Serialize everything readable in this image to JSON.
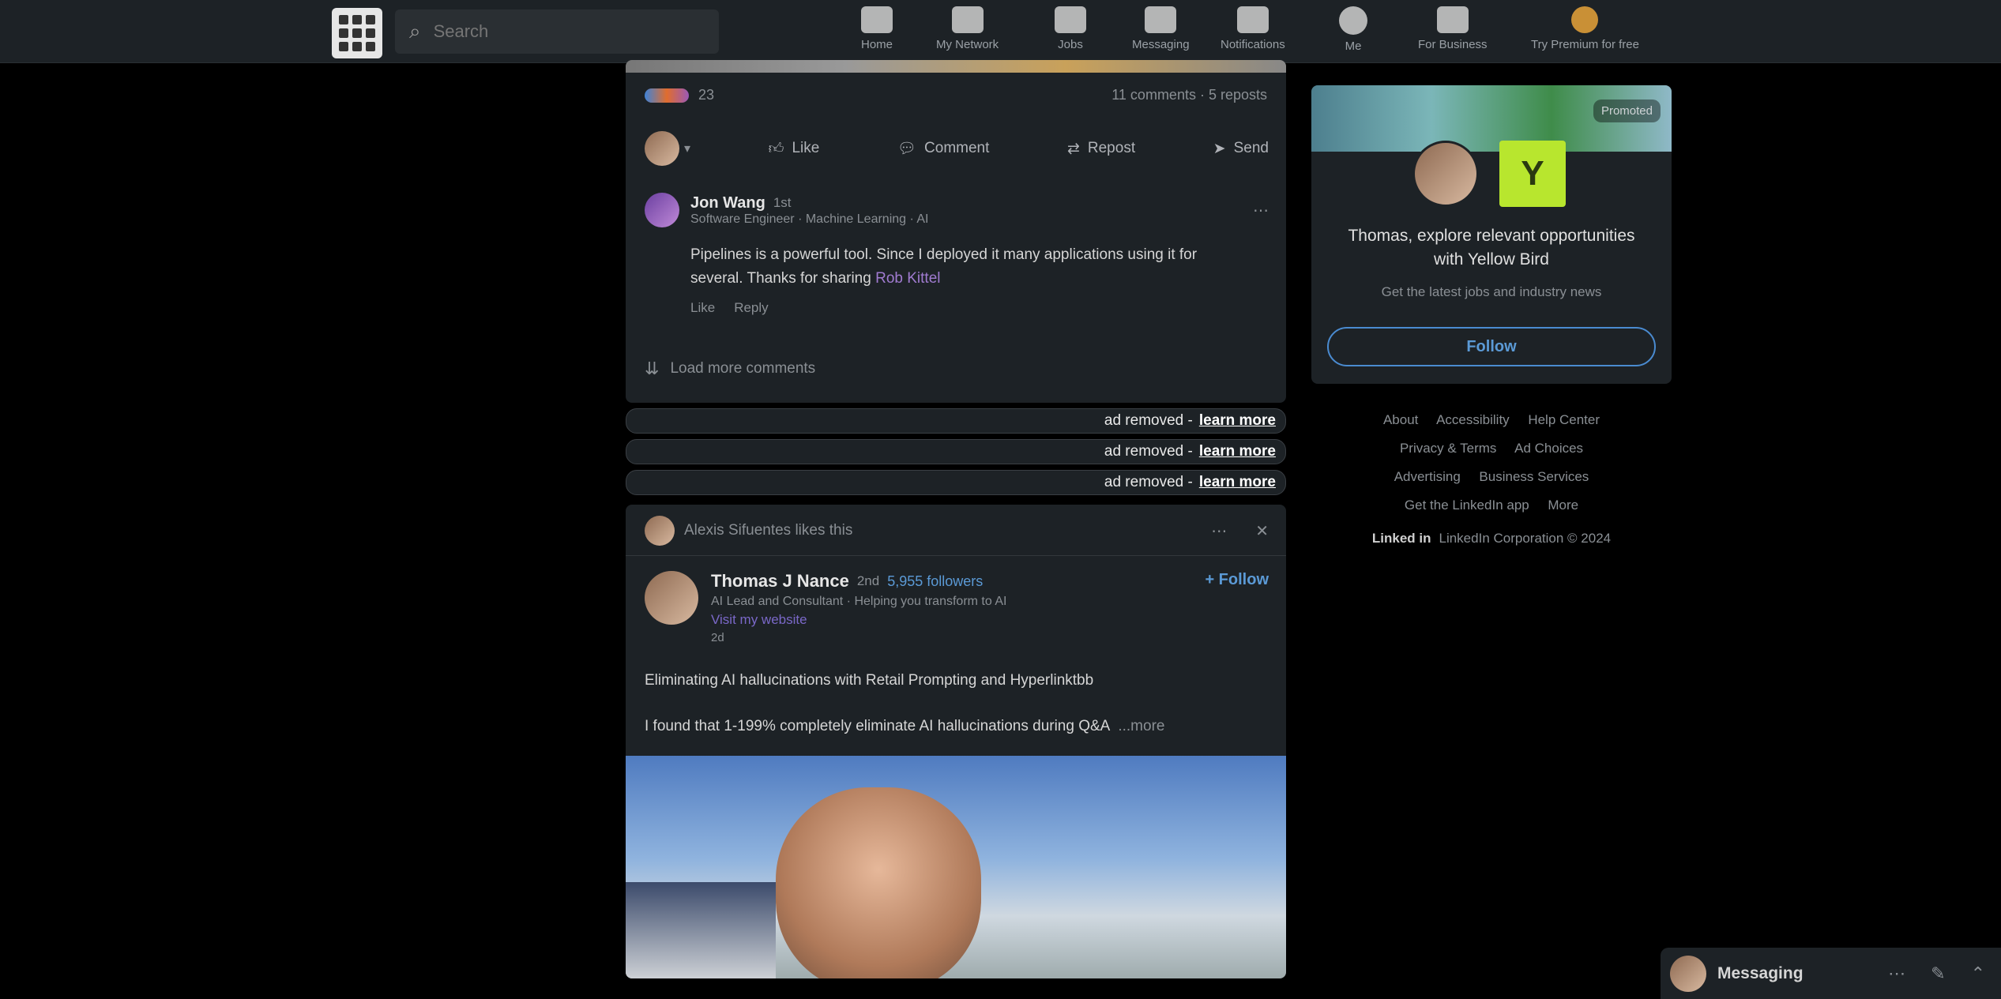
{
  "search": {
    "placeholder": "Search"
  },
  "nav": [
    {
      "label": "Home",
      "icon": "home-icon"
    },
    {
      "label": "My Network",
      "icon": "network-icon"
    },
    {
      "label": "Jobs",
      "icon": "briefcase-icon"
    },
    {
      "label": "Messaging",
      "icon": "chat-icon"
    },
    {
      "label": "Notifications",
      "icon": "bell-icon"
    },
    {
      "label": "Me",
      "icon": "avatar-icon"
    },
    {
      "label": "For Business",
      "icon": "grid-icon"
    },
    {
      "label": "Try Premium for free",
      "icon": "premium-icon"
    }
  ],
  "post1": {
    "reaction_count": "23",
    "stats": "11 comments · 5 reposts",
    "actions": [
      "Like",
      "Comment",
      "Repost",
      "Send"
    ],
    "comment": {
      "author": "Jon Wang",
      "meta": "1st",
      "headline": "Software Engineer · Machine Learning · AI",
      "text": "Pipelines is a powerful tool. Since I deployed it many applications using it for several. Thanks for sharing",
      "mention": "Rob Kittel",
      "actions": [
        "Like",
        "Reply"
      ]
    },
    "load_more": "Load more comments"
  },
  "ads": [
    {
      "text": "ad removed -",
      "link": "learn more"
    },
    {
      "text": "ad removed -",
      "link": "learn more"
    },
    {
      "text": "ad removed -",
      "link": "learn more"
    }
  ],
  "post2": {
    "context": "Alexis Sifuentes likes this",
    "author": "Thomas J Nance",
    "degree": "2nd",
    "followers": "5,955 followers",
    "headline": "AI Lead and Consultant · Helping you transform to AI",
    "link": "Visit my website",
    "time": "2d",
    "follow": "+ Follow",
    "text1": "Eliminating AI hallucinations with Retail Prompting and Hyperlinktbb",
    "text2": "I found that 1-199% completely eliminate AI hallucinations during Q&A",
    "more": "...more"
  },
  "sidebar": {
    "promo_text": "Thomas, explore relevant opportunities with Yellow Bird",
    "sub_text": "Get the latest jobs and industry news",
    "follow_btn": "Follow",
    "ad_label": "Promoted",
    "footer_links": [
      "About",
      "Accessibility",
      "Help Center",
      "Privacy & Terms",
      "Ad Choices",
      "Advertising",
      "Business Services",
      "Get the LinkedIn app",
      "More"
    ],
    "copyright": "LinkedIn Corporation © 2024"
  },
  "messaging": {
    "label": "Messaging"
  }
}
